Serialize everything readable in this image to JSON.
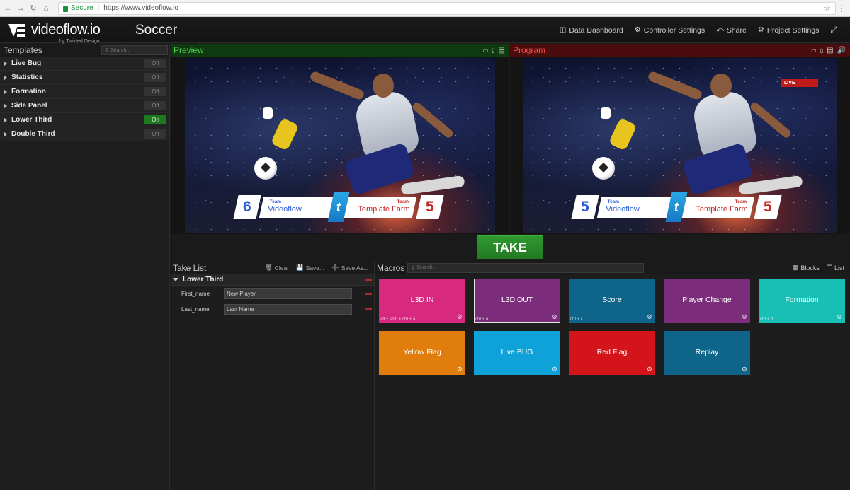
{
  "browser": {
    "secure_label": "Secure",
    "url": "https://www.videoflow.io"
  },
  "app": {
    "logo_text": "videoflow.io",
    "logo_sub": "by Twizted Design",
    "project": "Soccer",
    "actions": [
      {
        "label": "Data Dashboard",
        "icon": "database-icon"
      },
      {
        "label": "Controller Settings",
        "icon": "gears-icon"
      },
      {
        "label": "Share",
        "icon": "share-icon"
      },
      {
        "label": "Project Settings",
        "icon": "gear-icon"
      }
    ]
  },
  "templates": {
    "title": "Templates",
    "search_placeholder": "Search...",
    "items": [
      {
        "label": "Live Bug",
        "state": "Off"
      },
      {
        "label": "Statistics",
        "state": "Off"
      },
      {
        "label": "Formation",
        "state": "Off"
      },
      {
        "label": "Side Panel",
        "state": "Off"
      },
      {
        "label": "Lower Third",
        "state": "On"
      },
      {
        "label": "Double Third",
        "state": "Off"
      }
    ]
  },
  "preview": {
    "title": "Preview",
    "score_left": "6",
    "score_right": "5",
    "team_caption": "Team",
    "team_left": "Videoflow",
    "team_right": "Template Farm"
  },
  "program": {
    "title": "Program",
    "live_label": "LIVE",
    "score_left": "5",
    "score_right": "5",
    "team_caption": "Team",
    "team_left": "Videoflow",
    "team_right": "Template Farm"
  },
  "take": {
    "label": "TAKE"
  },
  "take_list": {
    "title": "Take List",
    "actions": {
      "clear": "Clear",
      "save": "Save...",
      "save_as": "Save As..."
    },
    "group": "Lower Third",
    "fields": [
      {
        "key": "First_name",
        "value": "New Player"
      },
      {
        "key": "Last_name",
        "value": "Last Name"
      }
    ]
  },
  "macros": {
    "title": "Macros",
    "search_placeholder": "Search...",
    "view_blocks": "Blocks",
    "view_list": "List",
    "tiles": [
      {
        "label": "L3D IN",
        "shortcut": "alt + shift + ctrl + a",
        "color": "#d6297f"
      },
      {
        "label": "L3D OUT",
        "shortcut": "ctrl + o",
        "color": "#7b2d7b"
      },
      {
        "label": "Score",
        "shortcut": "ctrl + i",
        "color": "#0e6589"
      },
      {
        "label": "Player Change",
        "shortcut": "",
        "color": "#7b2d7b"
      },
      {
        "label": "Formation",
        "shortcut": "ctrl + d",
        "color": "#17bfb5"
      },
      {
        "label": "Yellow Flag",
        "shortcut": "",
        "color": "#e07d0c"
      },
      {
        "label": "Live BUG",
        "shortcut": "",
        "color": "#0fa2d8"
      },
      {
        "label": "Red Flag",
        "shortcut": "",
        "color": "#d3141b"
      },
      {
        "label": "Replay",
        "shortcut": "",
        "color": "#0e6589"
      }
    ]
  }
}
